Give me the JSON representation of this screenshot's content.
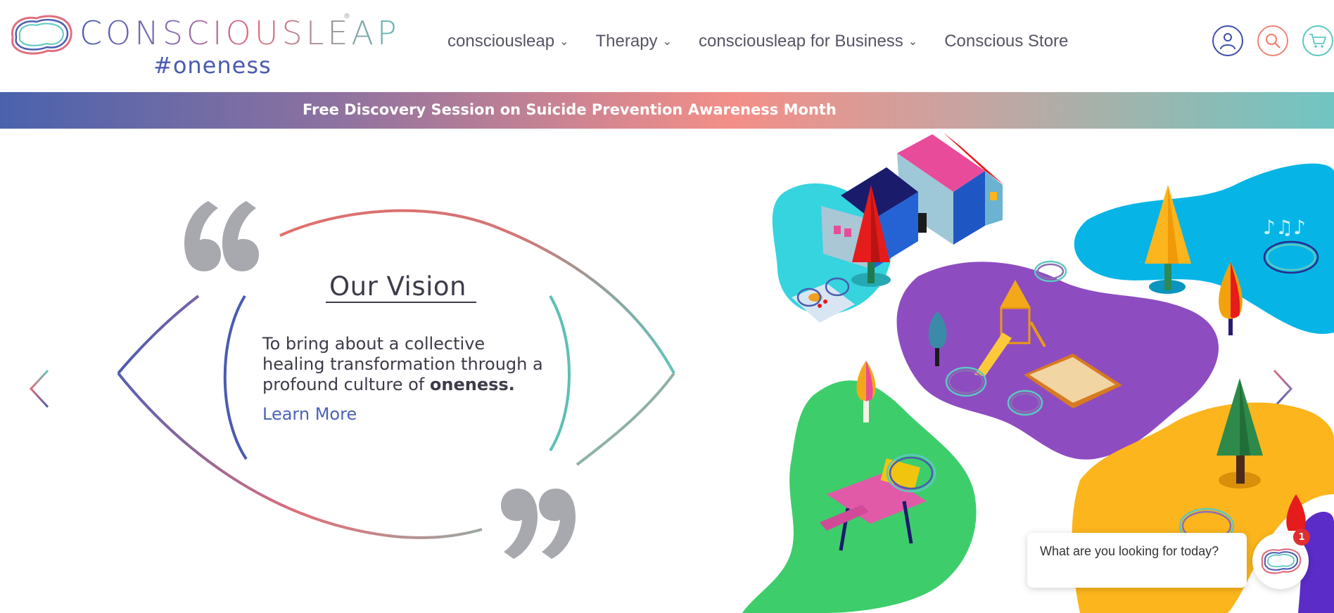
{
  "brand": {
    "name": "CONSCIOUSLEAP",
    "registered": "®",
    "tagline": "#oneness"
  },
  "nav": {
    "items": [
      {
        "label": "consciousleap",
        "has_dropdown": true
      },
      {
        "label": "Therapy",
        "has_dropdown": true
      },
      {
        "label": "consciousleap for Business",
        "has_dropdown": true
      },
      {
        "label": "Conscious Store",
        "has_dropdown": false
      }
    ],
    "icons": [
      "user-icon",
      "search-icon",
      "cart-icon"
    ]
  },
  "banner": {
    "text": "Free Discovery Session on Suicide Prevention Awareness Month"
  },
  "hero": {
    "title": "Our Vision",
    "body_prefix": "To bring about a collective healing transformation through a profound culture of ",
    "body_bold": "oneness.",
    "link": "Learn More",
    "illustration": "playground-park-illustration"
  },
  "carousel": {
    "prev_icon": "chevron-left-icon",
    "next_icon": "chevron-right-icon"
  },
  "chat": {
    "prompt": "What are you looking for today?",
    "badge_count": "1"
  },
  "colors": {
    "brand_blue": "#4a5bb0",
    "brand_coral": "#ee8575",
    "brand_teal": "#5cc9c0",
    "quote_gray": "#a8a9ae"
  }
}
